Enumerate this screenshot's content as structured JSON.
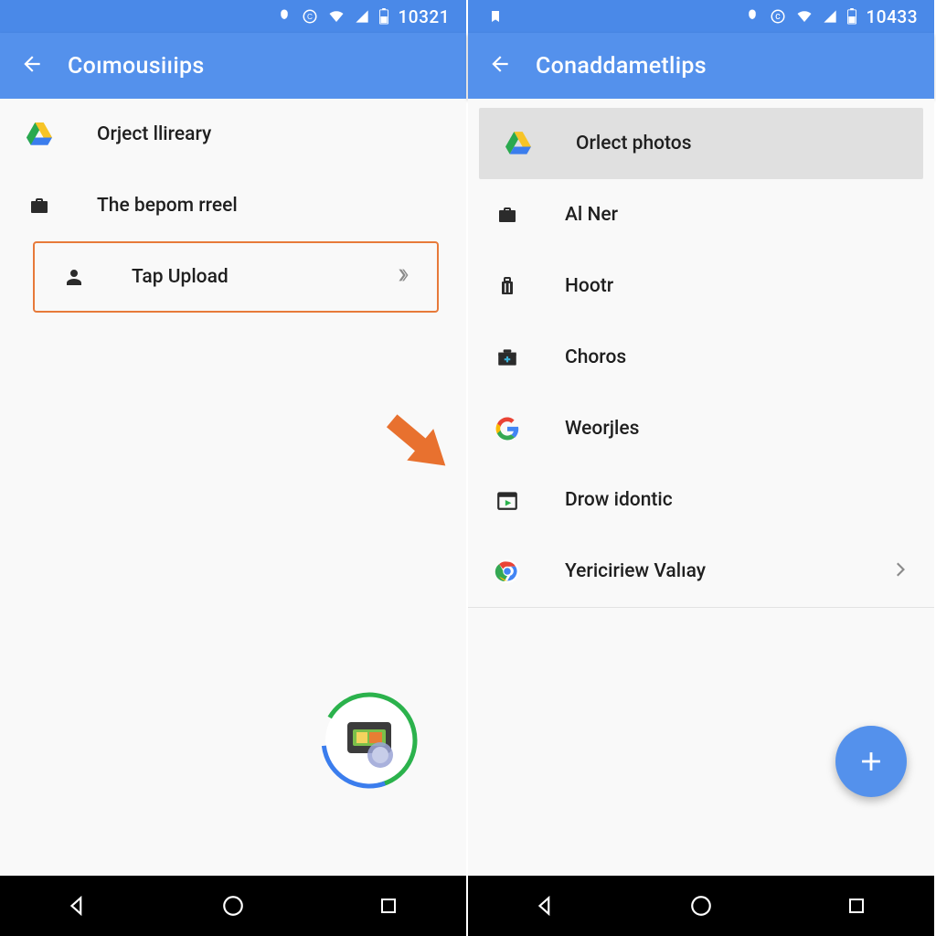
{
  "left": {
    "status": {
      "clock": "10321"
    },
    "appbar": {
      "title": "Coımousiıips"
    },
    "items": [
      {
        "label": "Orject llireary",
        "icon": "drive-icon"
      },
      {
        "label": "The bepom rreel",
        "icon": "briefcase-icon"
      },
      {
        "label": "Tap Upload",
        "icon": "person-icon",
        "highlight": true,
        "chevron": true
      }
    ]
  },
  "right": {
    "status": {
      "clock": "10433"
    },
    "appbar": {
      "title": "Conaddametlips"
    },
    "items": [
      {
        "label": "Orlect photos",
        "icon": "drive-icon",
        "selected": true
      },
      {
        "label": "Al Ner",
        "icon": "briefcase-icon"
      },
      {
        "label": "Hootr",
        "icon": "luggage-icon"
      },
      {
        "label": "Choros",
        "icon": "medkit-icon"
      },
      {
        "label": "Weorjles",
        "icon": "google-g-icon"
      },
      {
        "label": "Drow idontic",
        "icon": "play-calendar-icon"
      },
      {
        "label": "Yericiriew Valıay",
        "icon": "chrome-icon",
        "chevron": true
      }
    ]
  },
  "colors": {
    "accent": "#5491ec",
    "highlight": "#e77a3a"
  }
}
